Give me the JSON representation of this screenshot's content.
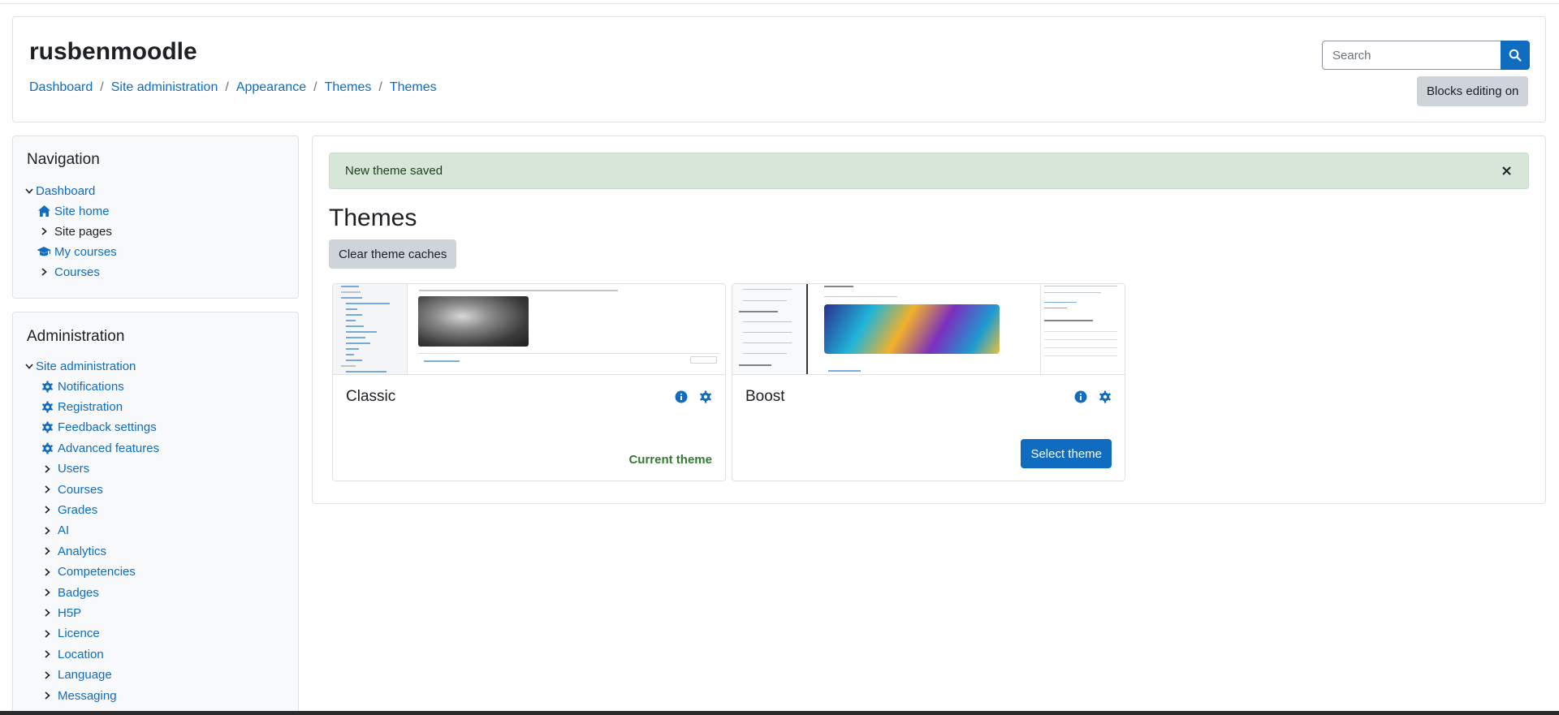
{
  "site": {
    "title": "rusbenmoodle"
  },
  "breadcrumb": [
    "Dashboard",
    "Site administration",
    "Appearance",
    "Themes",
    "Themes"
  ],
  "search": {
    "placeholder": "Search"
  },
  "header": {
    "blocks_editing_label": "Blocks editing on"
  },
  "navigation": {
    "title": "Navigation",
    "items": [
      {
        "label": "Dashboard",
        "icon": "chevron-down-icon"
      },
      {
        "label": "Site home",
        "icon": "home-icon"
      },
      {
        "label": "Site pages",
        "icon": "chevron-right-icon"
      },
      {
        "label": "My courses",
        "icon": "graduation-cap-icon"
      },
      {
        "label": "Courses",
        "icon": "chevron-right-icon"
      }
    ]
  },
  "administration": {
    "title": "Administration",
    "root": "Site administration",
    "items": [
      "Notifications",
      "Registration",
      "Feedback settings",
      "Advanced features",
      "Users",
      "Courses",
      "Grades",
      "AI",
      "Analytics",
      "Competencies",
      "Badges",
      "H5P",
      "Licence",
      "Location",
      "Language",
      "Messaging"
    ]
  },
  "alert": {
    "message": "New theme saved"
  },
  "main": {
    "title": "Themes",
    "clear_caches_label": "Clear theme caches"
  },
  "themes": [
    {
      "name": "Classic",
      "status": "Current theme"
    },
    {
      "name": "Boost",
      "action_label": "Select theme"
    }
  ],
  "colors": {
    "primary": "#0f6cbf",
    "success_text": "#357a32",
    "alert_bg": "#d7e6d9",
    "secondary_btn": "#ced4da"
  }
}
